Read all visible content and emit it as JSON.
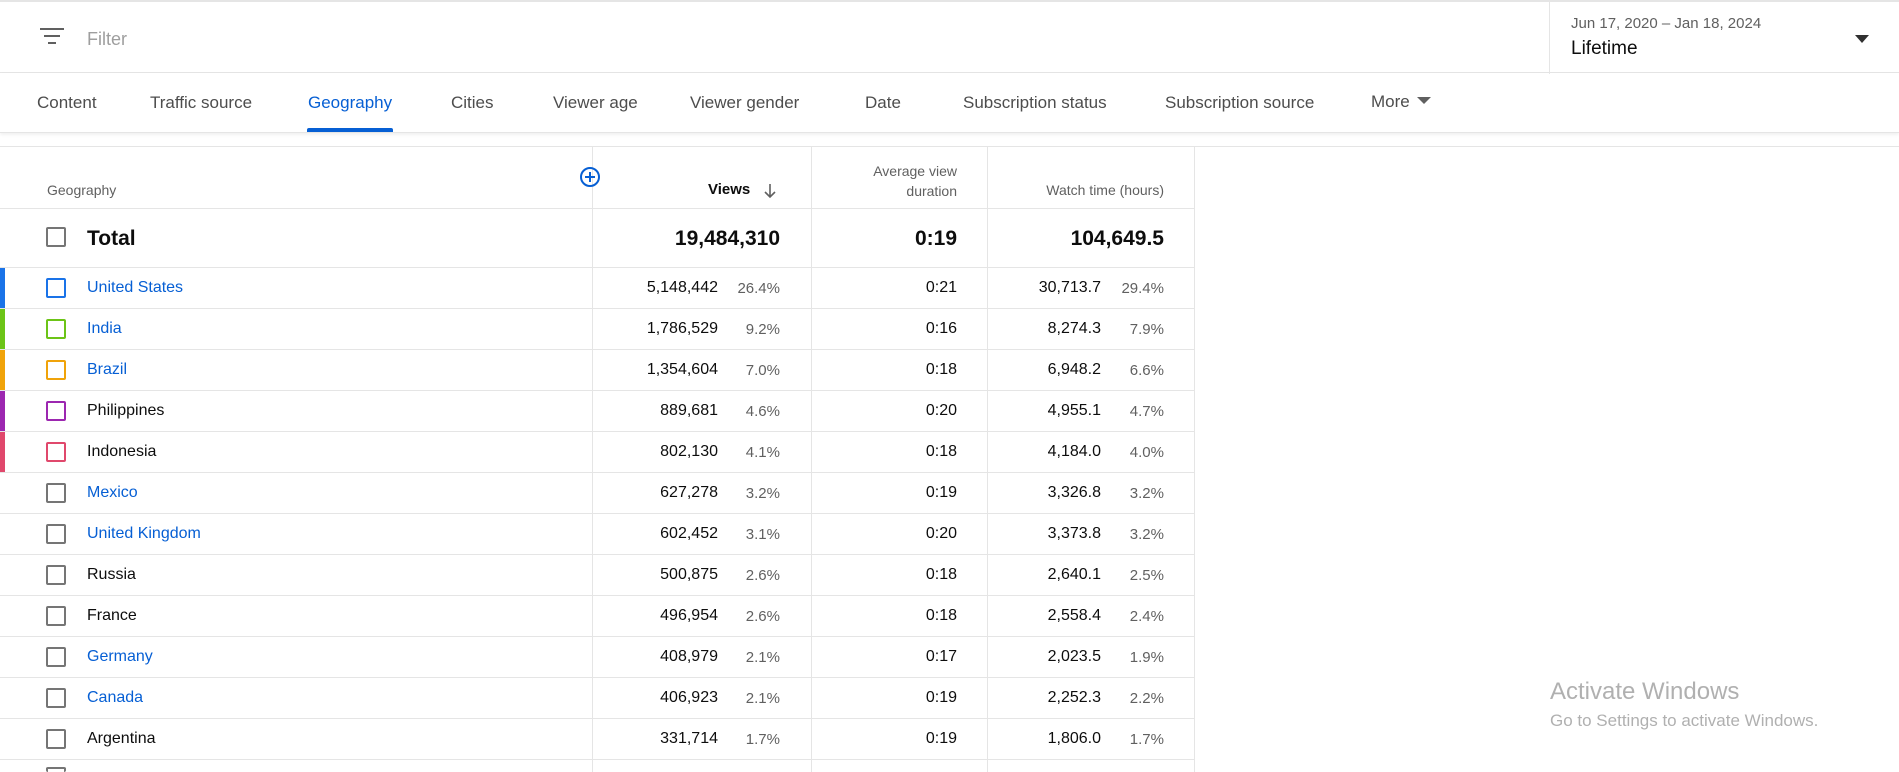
{
  "filter": {
    "placeholder": "Filter"
  },
  "date_selector": {
    "range": "Jun 17, 2020 – Jan 18, 2024",
    "period": "Lifetime"
  },
  "tabs": [
    {
      "label": "Content"
    },
    {
      "label": "Traffic source"
    },
    {
      "label": "Geography",
      "active": true
    },
    {
      "label": "Cities"
    },
    {
      "label": "Viewer age"
    },
    {
      "label": "Viewer gender"
    },
    {
      "label": "Date"
    },
    {
      "label": "Subscription status"
    },
    {
      "label": "Subscription source"
    },
    {
      "label": "More"
    }
  ],
  "table": {
    "headers": {
      "geography": "Geography",
      "views": "Views",
      "avg_duration_line1": "Average view",
      "avg_duration_line2": "duration",
      "watch_time": "Watch time (hours)"
    },
    "total": {
      "label": "Total",
      "views": "19,484,310",
      "avg_duration": "0:19",
      "watch_time": "104,649.5"
    },
    "rows": [
      {
        "country": "United States",
        "views": "5,148,442",
        "views_pct": "26.4%",
        "avg_duration": "0:21",
        "watch_time": "30,713.7",
        "watch_pct": "29.4%",
        "link": true,
        "color": "#1a73e8"
      },
      {
        "country": "India",
        "views": "1,786,529",
        "views_pct": "9.2%",
        "avg_duration": "0:16",
        "watch_time": "8,274.3",
        "watch_pct": "7.9%",
        "link": true,
        "color": "#6cc417"
      },
      {
        "country": "Brazil",
        "views": "1,354,604",
        "views_pct": "7.0%",
        "avg_duration": "0:18",
        "watch_time": "6,948.2",
        "watch_pct": "6.6%",
        "link": true,
        "color": "#f0a30a"
      },
      {
        "country": "Philippines",
        "views": "889,681",
        "views_pct": "4.6%",
        "avg_duration": "0:20",
        "watch_time": "4,955.1",
        "watch_pct": "4.7%",
        "link": false,
        "color": "#9c27b0"
      },
      {
        "country": "Indonesia",
        "views": "802,130",
        "views_pct": "4.1%",
        "avg_duration": "0:18",
        "watch_time": "4,184.0",
        "watch_pct": "4.0%",
        "link": false,
        "color": "#e0486c"
      },
      {
        "country": "Mexico",
        "views": "627,278",
        "views_pct": "3.2%",
        "avg_duration": "0:19",
        "watch_time": "3,326.8",
        "watch_pct": "3.2%",
        "link": true,
        "color": ""
      },
      {
        "country": "United Kingdom",
        "views": "602,452",
        "views_pct": "3.1%",
        "avg_duration": "0:20",
        "watch_time": "3,373.8",
        "watch_pct": "3.2%",
        "link": true,
        "color": ""
      },
      {
        "country": "Russia",
        "views": "500,875",
        "views_pct": "2.6%",
        "avg_duration": "0:18",
        "watch_time": "2,640.1",
        "watch_pct": "2.5%",
        "link": false,
        "color": ""
      },
      {
        "country": "France",
        "views": "496,954",
        "views_pct": "2.6%",
        "avg_duration": "0:18",
        "watch_time": "2,558.4",
        "watch_pct": "2.4%",
        "link": false,
        "color": ""
      },
      {
        "country": "Germany",
        "views": "408,979",
        "views_pct": "2.1%",
        "avg_duration": "0:17",
        "watch_time": "2,023.5",
        "watch_pct": "1.9%",
        "link": true,
        "color": ""
      },
      {
        "country": "Canada",
        "views": "406,923",
        "views_pct": "2.1%",
        "avg_duration": "0:19",
        "watch_time": "2,252.3",
        "watch_pct": "2.2%",
        "link": true,
        "color": ""
      },
      {
        "country": "Argentina",
        "views": "331,714",
        "views_pct": "1.7%",
        "avg_duration": "0:19",
        "watch_time": "1,806.0",
        "watch_pct": "1.7%",
        "link": false,
        "color": ""
      }
    ]
  },
  "watermark": {
    "line1": "Activate Windows",
    "line2": "Go to Settings to activate Windows."
  },
  "icons": {
    "filter": "filter-icon",
    "dropdown": "chevron-down-icon",
    "add_column": "add-circle-icon",
    "sort": "arrow-down-icon"
  }
}
